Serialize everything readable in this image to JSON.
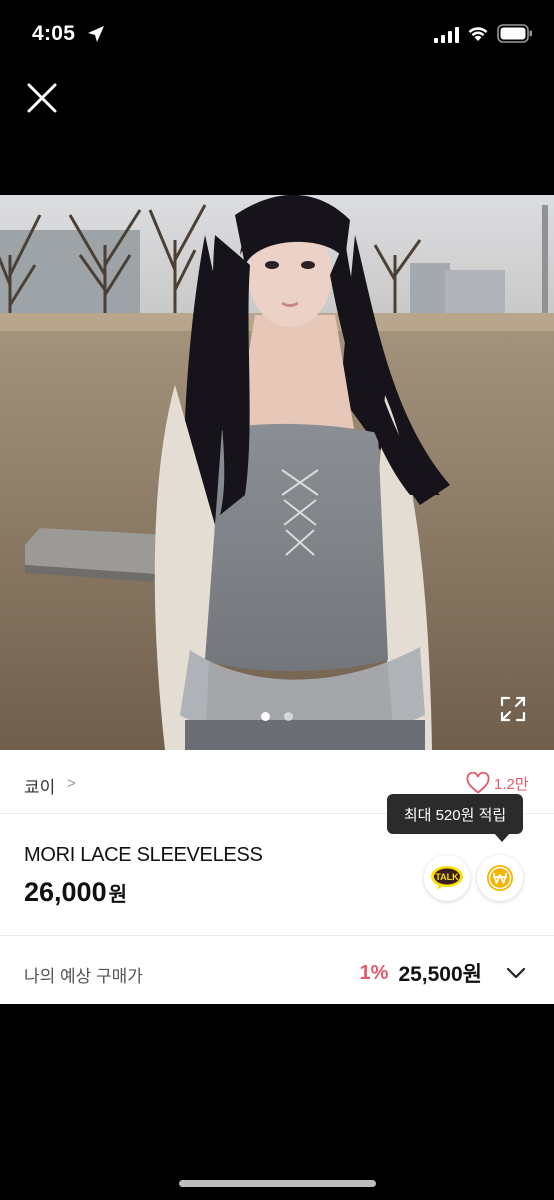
{
  "status_bar": {
    "time": "4:05"
  },
  "icons": {
    "close": "close-icon",
    "expand": "expand-icon",
    "heart": "heart-icon",
    "talk": "kakao-talk-icon",
    "point": "won-coin-icon",
    "chevron_down": "chevron-down-icon"
  },
  "carousel": {
    "total": 2,
    "active": 1
  },
  "shop": {
    "name": "쿄이",
    "chevron": ">"
  },
  "likes": {
    "count": "1.2만"
  },
  "tooltip": {
    "text": "최대 520원 적립"
  },
  "product": {
    "name": "MORI LACE SLEEVELESS",
    "price": "26,000",
    "currency": "원"
  },
  "talk": {
    "label": "TALK"
  },
  "expected_price": {
    "label": "나의 예상 구매가",
    "rate": "1%",
    "price": "25,500원"
  },
  "colors": {
    "accent": "#e35b6a",
    "kakao_yellow": "#f9e000",
    "point_gold": "#f5b400"
  }
}
